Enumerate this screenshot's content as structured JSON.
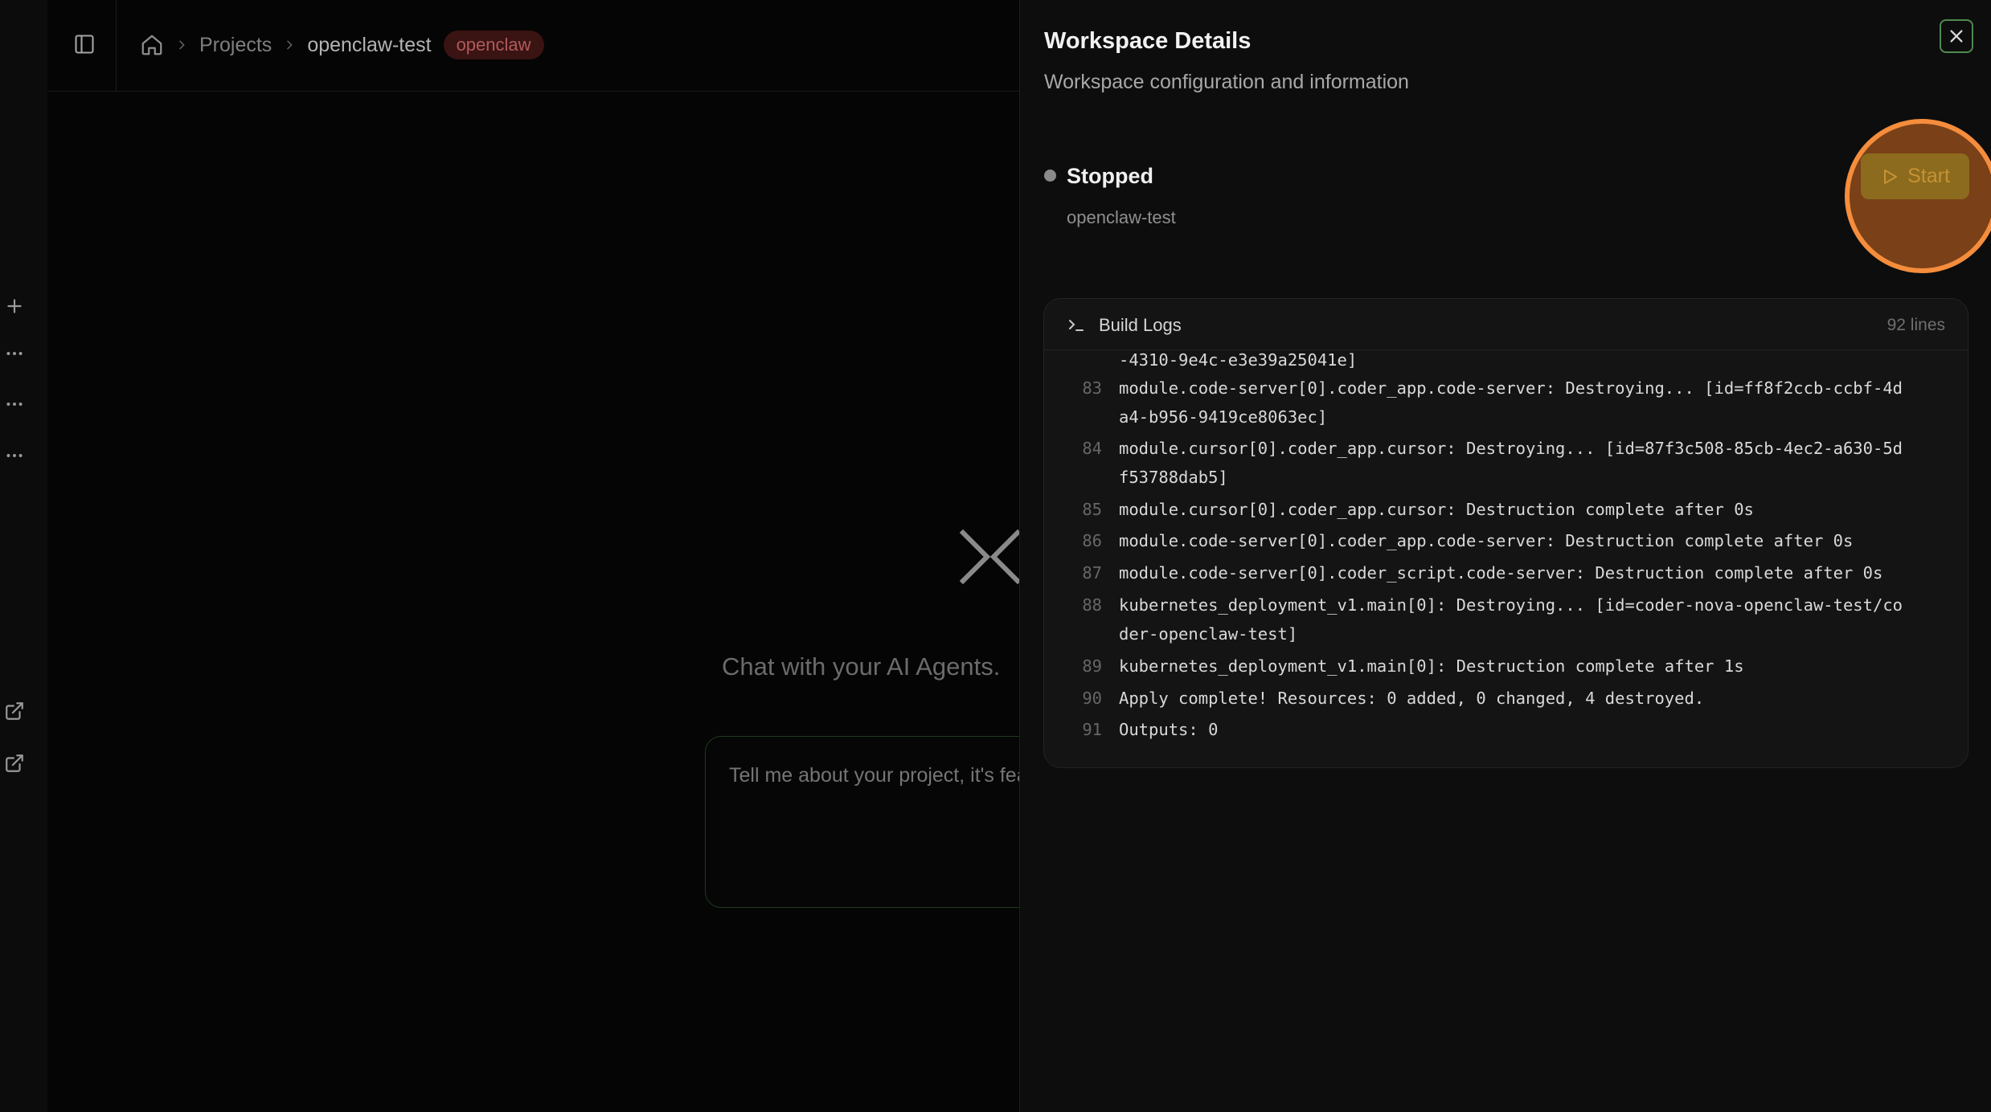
{
  "breadcrumb": {
    "projects_label": "Projects",
    "current_label": "openclaw-test",
    "badge_label": "openclaw"
  },
  "main": {
    "hero_text": "Chat with your AI Agents.",
    "chat_placeholder": "Tell me about your project, it's featu"
  },
  "panel": {
    "title": "Workspace Details",
    "subtitle": "Workspace configuration and information",
    "status": "Stopped",
    "workspace_name": "openclaw-test",
    "start_label": "Start",
    "logs_title": "Build Logs",
    "logs_count": "92 lines",
    "log_lines": [
      {
        "num": "",
        "text": "-4310-9e4c-e3e39a25041e]"
      },
      {
        "num": "83",
        "text": "module.code-server[0].coder_app.code-server: Destroying... [id=ff8f2ccb-ccbf-4d"
      },
      {
        "num": "",
        "text": "a4-b956-9419ce8063ec]"
      },
      {
        "num": "84",
        "text": "module.cursor[0].coder_app.cursor: Destroying... [id=87f3c508-85cb-4ec2-a630-5d"
      },
      {
        "num": "",
        "text": "f53788dab5]"
      },
      {
        "num": "85",
        "text": "module.cursor[0].coder_app.cursor: Destruction complete after 0s"
      },
      {
        "num": "86",
        "text": "module.code-server[0].coder_app.code-server: Destruction complete after 0s"
      },
      {
        "num": "87",
        "text": "module.code-server[0].coder_script.code-server: Destruction complete after 0s"
      },
      {
        "num": "88",
        "text": "kubernetes_deployment_v1.main[0]: Destroying... [id=coder-nova-openclaw-test/co"
      },
      {
        "num": "",
        "text": "der-openclaw-test]"
      },
      {
        "num": "89",
        "text": "kubernetes_deployment_v1.main[0]: Destruction complete after 1s"
      },
      {
        "num": "90",
        "text": "Apply complete! Resources: 0 added, 0 changed, 4 destroyed."
      },
      {
        "num": "91",
        "text": "Outputs: 0"
      }
    ]
  },
  "icons": {
    "rail": [
      "plus-icon",
      "more-icon",
      "more-icon",
      "more-icon",
      "external-link-icon",
      "external-link-icon"
    ],
    "sidebar_toggle": "sidebar-icon",
    "home": "home-icon",
    "close": "close-icon",
    "start": "play-icon",
    "logs": "terminal-icon"
  },
  "colors": {
    "accent_highlight": "#f58d3c",
    "badge_bg": "#3a1313",
    "badge_text": "#b15a5a",
    "start_button": "#8c6b1e",
    "close_border": "#4f8a4f"
  }
}
